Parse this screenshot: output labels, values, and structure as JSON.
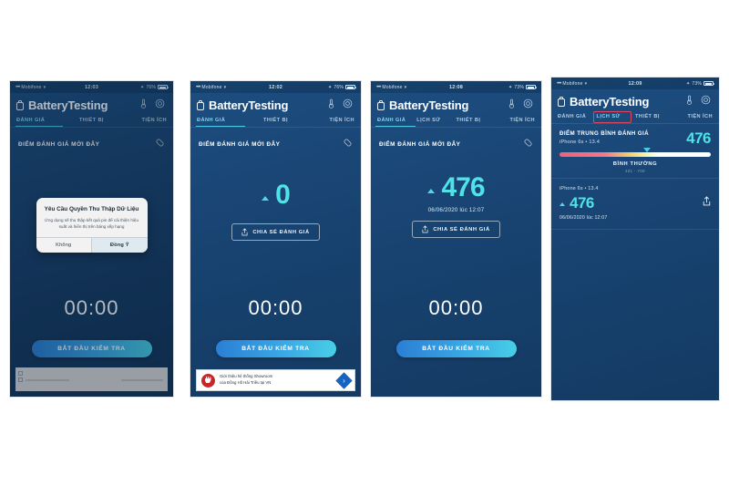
{
  "app": {
    "title": "BatteryTesting",
    "brand_icon": "battery-icon",
    "header_icons": [
      "thermometer-icon",
      "settings-gear-icon"
    ],
    "link_icon": "link-chain-icon",
    "share_icon": "share-upload-icon"
  },
  "colors": {
    "accent_cyan": "#4fe3e8",
    "tab_active": "#7fd9ef",
    "start_button_start": "#2a7fd4",
    "start_button_end": "#47cfe6",
    "highlight_box": "#e0465b",
    "meter_low": "#f0607a",
    "meter_mid": "#f2cf6b",
    "meter_high": "#ffffff"
  },
  "screens": [
    {
      "id": "screen-permission-dialog",
      "status_bar": {
        "carrier": "Mobifone",
        "time": "12:03",
        "battery": "76%"
      },
      "tabs": [
        {
          "label": "ĐÁNH GIÁ",
          "active": true
        },
        {
          "label": "THIẾT BỊ",
          "active": false
        },
        {
          "label": "TIỆN ÍCH",
          "active": false
        }
      ],
      "section_title": "ĐIỂM ĐÁNH GIÁ MỚI ĐÂY",
      "timer": "00:00",
      "start_button": "BẮT ĐẦU KIỂM TRA",
      "dialog": {
        "title": "Yêu Cầu Quyền Thu Thập Dữ Liệu",
        "message": "Ứng dụng sẽ thu thập kết quả pin để cải thiện hiệu suất và hiển thị trên bảng xếp hạng",
        "deny_label": "Không",
        "accept_label": "Đồng Ý"
      },
      "ad": {
        "type": "blank-placeholder"
      }
    },
    {
      "id": "screen-score-zero",
      "status_bar": {
        "carrier": "Mobifone",
        "time": "12:02",
        "battery": "76%"
      },
      "tabs": [
        {
          "label": "ĐÁNH GIÁ",
          "active": true
        },
        {
          "label": "THIẾT BỊ",
          "active": false
        },
        {
          "label": "TIỆN ÍCH",
          "active": false
        }
      ],
      "section_title": "ĐIỂM ĐÁNH GIÁ MỚI ĐÂY",
      "score": "0",
      "share_button": "CHIA SẺ ĐÁNH GIÁ",
      "timer": "00:00",
      "start_button": "BẮT ĐẦU KIỂM TRA",
      "ad": {
        "type": "banner",
        "line1": "Giới thiệu hệ thống Showroom",
        "line2": "của Đồng Hồ Hải Triều tại VN",
        "logo": "hai-trieu-logo",
        "cta_icon": "arrow-right-icon"
      }
    },
    {
      "id": "screen-score-476",
      "status_bar": {
        "carrier": "Mobifone",
        "time": "12:08",
        "battery": "73%"
      },
      "tabs": [
        {
          "label": "ĐÁNH GIÁ",
          "active": true
        },
        {
          "label": "LỊCH SỬ",
          "active": false
        },
        {
          "label": "THIẾT BỊ",
          "active": false
        },
        {
          "label": "TIỆN ÍCH",
          "active": false
        }
      ],
      "section_title": "ĐIỂM ĐÁNH GIÁ MỚI ĐÂY",
      "score": "476",
      "score_date": "06/06/2020 lúc 12:07",
      "share_button": "CHIA SẺ ĐÁNH GIÁ",
      "timer": "00:00",
      "start_button": "BẮT ĐẦU KIỂM TRA"
    },
    {
      "id": "screen-history",
      "status_bar": {
        "carrier": "Mobifone",
        "time": "12:09",
        "battery": "73%"
      },
      "tabs": [
        {
          "label": "ĐÁNH GIÁ",
          "active": false
        },
        {
          "label": "LỊCH SỬ",
          "active": true,
          "highlighted": true
        },
        {
          "label": "THIẾT BỊ",
          "active": false
        },
        {
          "label": "TIỆN ÍCH",
          "active": false
        }
      ],
      "average": {
        "label": "ĐIỂM TRUNG BÌNH ĐÁNH GIÁ",
        "device": "iPhone 6s • 13.4",
        "score": "476",
        "meter_level": "BÌNH THƯỜNG",
        "meter_range": "401 - 700",
        "meter_position_pct": 58
      },
      "history_items": [
        {
          "device": "iPhone 6s • 13.4",
          "score": "476",
          "date": "06/06/2020 lúc 12:07",
          "share_icon": "share-upload-icon"
        }
      ]
    }
  ]
}
